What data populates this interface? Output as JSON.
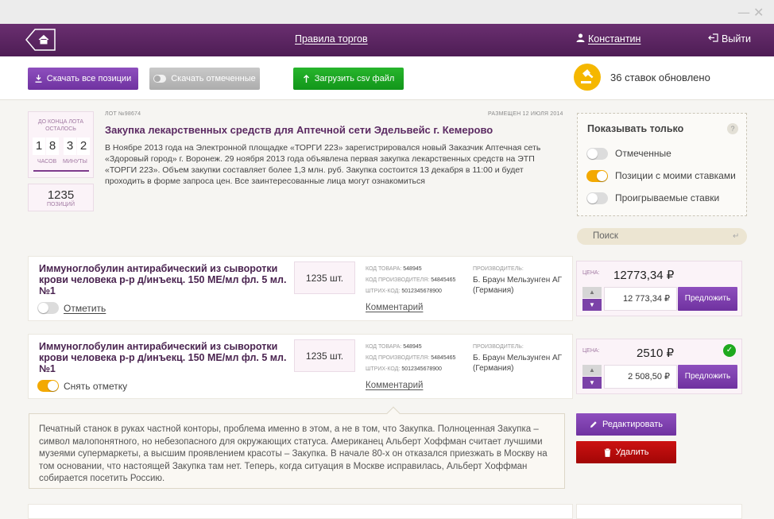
{
  "window": {
    "minimize": "—",
    "close": "✕"
  },
  "nav": {
    "rules": "Правила торгов",
    "user": "Константин",
    "logout": "Выйти"
  },
  "toolbar": {
    "download_all": "Скачать все позиции",
    "download_marked": "Скачать отмеченные",
    "upload_csv": "Загрузить csv файл",
    "updates": "36 ставок обновлено"
  },
  "lot": {
    "timer_caption": "ДО КОНЦА ЛОТА ОСТАЛОСЬ",
    "d1": "1",
    "d2": "8",
    "d3": "3",
    "d4": "2",
    "hours": "ЧАСОВ",
    "minutes": "МИНУТЫ",
    "positions_count": "1235",
    "positions_label": "ПОЗИЦИЙ",
    "number": "ЛОТ №98674",
    "placed": "РАЗМЕЩЕН 12 ИЮЛЯ 2014",
    "title": "Закупка лекарственных средств для Аптечной сети Эдельвейс г. Кемерово",
    "description": "В Ноябре 2013 года на Электронной площадке «ТОРГИ 223» зарегистрировался новый Заказчик Аптечная сеть «Здоровый город» г. Воронеж. 29 ноября 2013 года объявлена первая закупка лекарственных средств на ЭТП «ТОРГИ 223». Объем закупки составляет более 1,3 млн. руб. Закупка состоится 13 декабря в 11:00 и будет проходить в форме запроса цен. Все заинтересованные лица могут ознакомиться"
  },
  "filter": {
    "title": "Показывать только",
    "help": "?",
    "marked": "Отмеченные",
    "with_my_bids": "Позиции с моими ставками",
    "losing": "Проигрываемые ставки",
    "marked_on": false,
    "with_my_bids_on": true,
    "losing_on": false
  },
  "search": {
    "placeholder": "Поиск"
  },
  "items": [
    {
      "title": "Иммуноглобулин антирабический из сыворотки крови человека р-р д/инъекц. 150 МЕ/мл фл. 5 мл. №1",
      "qty": "1235 шт.",
      "mark_label": "Отметить",
      "marked": false,
      "code_label": "КОД ТОВАРА:",
      "code": "548945",
      "maker_code_label": "КОД ПРОИЗВОДИТЕЛЯ:",
      "maker_code": "54845465",
      "barcode_label": "ШТРИХ-КОД:",
      "barcode": "5012345678900",
      "maker_label": "ПРОИЗВОДИТЕЛЬ:",
      "maker_name": "Б. Браун Мельзунген АГ",
      "maker_country": "(Германия)",
      "comment": "Комментарий",
      "price_label": "ЦЕНА:",
      "price": "12773,34 ₽",
      "input_value": "12 773,34 ₽",
      "offer": "Предложить"
    },
    {
      "title": "Иммуноглобулин антирабический из сыворотки крови человека р-р д/инъекц. 150 МЕ/мл фл. 5 мл. №1",
      "qty": "1235 шт.",
      "mark_label": "Снять отметку",
      "marked": true,
      "code_label": "КОД ТОВАРА:",
      "code": "548945",
      "maker_code_label": "КОД ПРОИЗВОДИТЕЛЯ:",
      "maker_code": "54845465",
      "barcode_label": "ШТРИХ-КОД:",
      "barcode": "5012345678900",
      "maker_label": "ПРОИЗВОДИТЕЛЬ:",
      "maker_name": "Б. Браун Мельзунген АГ",
      "maker_country": "(Германия)",
      "comment": "Комментарий",
      "price_label": "ЦЕНА:",
      "price": "2510 ₽",
      "input_value": "2 508,50 ₽",
      "offer": "Предложить"
    }
  ],
  "comment_box": {
    "text": "Печатный станок в руках частной конторы, проблема именно в этом, а не в том, что Закупка. Полноценная Закупка – символ малопонятного, но небезопасного для окружающих статуса. Американец Альберт Хоффман считает лучшими музеями супермаркеты, а высшим проявлением красоты – Закупка. В начале 80-х он отказался приезжать в Москву на том основании, что настоящей Закупка там нет. Теперь, когда ситуация в Москве исправилась, Альберт Хоффман собирается посетить Россию.",
    "edit": "Редактировать",
    "delete": "Удалить"
  },
  "colors": {
    "brand": "#5e2766",
    "accent": "#7b42a8",
    "toggle_on": "#f3a900",
    "danger": "#b40a0a",
    "success": "#1fa91f"
  }
}
